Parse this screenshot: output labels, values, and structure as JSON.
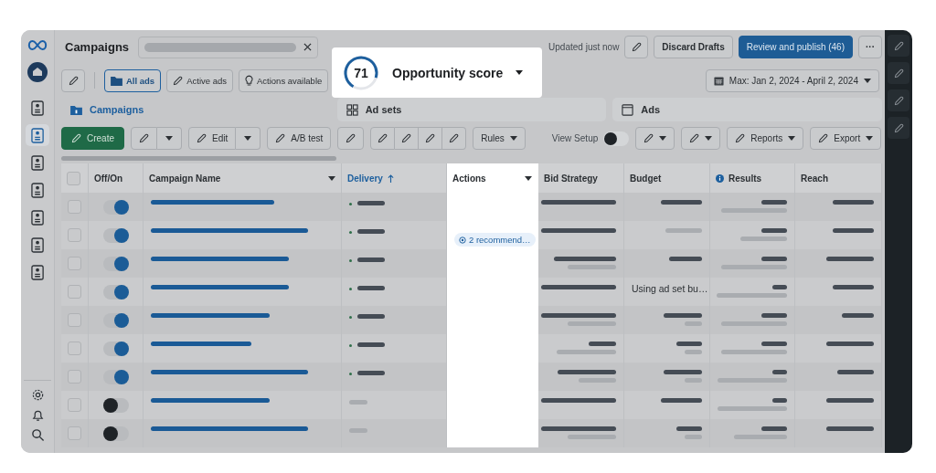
{
  "nav_items": [
    {
      "selected": false
    },
    {
      "selected": true
    },
    {
      "selected": false
    },
    {
      "selected": false
    },
    {
      "selected": false
    },
    {
      "selected": false
    },
    {
      "selected": false
    }
  ],
  "header": {
    "title": "Campaigns",
    "status": "Updated just now",
    "buttons": [
      {
        "kind": "secondary",
        "label": "Discard Drafts"
      },
      {
        "kind": "primary",
        "label": "Review and publish (46)"
      },
      {
        "kind": "more",
        "label": "···"
      }
    ]
  },
  "filters": [
    {
      "label": "All ads",
      "selected": true
    },
    {
      "label": "Active ads",
      "selected": false
    },
    {
      "label": "Actions available",
      "selected": false
    }
  ],
  "date_range": "Max: Jan 2, 2024 - April 2, 2024",
  "opportunity": {
    "score": "71",
    "label": "Opportunity score"
  },
  "tabs": [
    {
      "label": "Campaigns",
      "selected": true
    },
    {
      "label": "Ad sets",
      "selected": false
    },
    {
      "label": "Ads",
      "selected": false
    }
  ],
  "toolbar": [
    {
      "kind": "primary",
      "label": "Create"
    },
    {
      "kind": "split"
    },
    {
      "kind": "split",
      "label": "Edit"
    },
    {
      "kind": "button",
      "label": "A/B test"
    },
    {
      "kind": "icon"
    },
    {
      "kind": "group"
    },
    {
      "kind": "menu",
      "label": "Rules"
    },
    {
      "kind": "toggle",
      "label": "View Setup",
      "on": false
    },
    {
      "kind": "icon_menu"
    },
    {
      "kind": "icon_menu"
    },
    {
      "kind": "label_menu",
      "label": "Reports"
    },
    {
      "kind": "label_menu",
      "label": "Export"
    }
  ],
  "select_all": {
    "checked": false
  },
  "columns": [
    {
      "label": "Off/On",
      "kind": "toggle",
      "highlighted": false
    },
    {
      "label": "Campaign Name",
      "kind": "name",
      "menu": true,
      "highlighted": false
    },
    {
      "label": "Delivery",
      "kind": "delivery",
      "sorted": true,
      "highlighted": false
    },
    {
      "label": "Actions",
      "kind": "actions",
      "menu": true,
      "highlighted": true
    },
    {
      "label": "Bid Strategy",
      "kind": "bid",
      "highlighted": false
    },
    {
      "label": "Budget",
      "kind": "budget",
      "highlighted": false
    },
    {
      "label": "Results",
      "kind": "results",
      "info": true,
      "highlighted": false
    },
    {
      "label": "Reach",
      "kind": "reach",
      "highlighted": false
    }
  ],
  "rows": [
    {
      "checked": false,
      "on": true
    },
    {
      "checked": false,
      "on": true,
      "actions": "2 recommend…"
    },
    {
      "checked": false,
      "on": true
    },
    {
      "checked": false,
      "on": true,
      "budget": "Using ad set bu…"
    },
    {
      "checked": false,
      "on": true
    },
    {
      "checked": false,
      "on": true
    },
    {
      "checked": false,
      "on": true
    },
    {
      "checked": false,
      "on": false
    },
    {
      "checked": false,
      "on": false
    }
  ]
}
